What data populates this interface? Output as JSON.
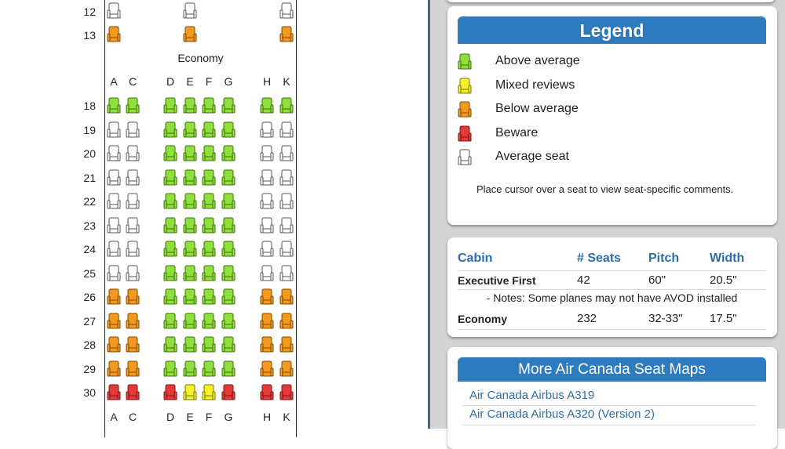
{
  "seat_map": {
    "section_label": "Economy",
    "colors": {
      "above": "#8fe03a",
      "mixed": "#f5f02a",
      "below": "#f39a1e",
      "beware": "#e43b37",
      "average": "#ffffff"
    },
    "columns": [
      "A",
      "C",
      "D",
      "E",
      "F",
      "G",
      "H",
      "K"
    ],
    "upper_rows": [
      {
        "row": "12",
        "seats": {
          "A": "average",
          "E": "average",
          "K": "average"
        }
      },
      {
        "row": "13",
        "seats": {
          "A": "below",
          "E": "below",
          "K": "below"
        }
      }
    ],
    "rows": [
      {
        "row": "18",
        "seats": [
          "above",
          "above",
          "above",
          "above",
          "above",
          "above",
          "above",
          "above"
        ]
      },
      {
        "row": "19",
        "seats": [
          "average",
          "average",
          "above",
          "above",
          "above",
          "above",
          "average",
          "average"
        ]
      },
      {
        "row": "20",
        "seats": [
          "average",
          "average",
          "above",
          "above",
          "above",
          "above",
          "average",
          "average"
        ]
      },
      {
        "row": "21",
        "seats": [
          "average",
          "average",
          "above",
          "above",
          "above",
          "above",
          "average",
          "average"
        ]
      },
      {
        "row": "22",
        "seats": [
          "average",
          "average",
          "above",
          "above",
          "above",
          "above",
          "average",
          "average"
        ]
      },
      {
        "row": "23",
        "seats": [
          "average",
          "average",
          "above",
          "above",
          "above",
          "above",
          "average",
          "average"
        ]
      },
      {
        "row": "24",
        "seats": [
          "average",
          "average",
          "above",
          "above",
          "above",
          "above",
          "average",
          "average"
        ]
      },
      {
        "row": "25",
        "seats": [
          "average",
          "average",
          "above",
          "above",
          "above",
          "above",
          "average",
          "average"
        ]
      },
      {
        "row": "26",
        "seats": [
          "below",
          "below",
          "above",
          "above",
          "above",
          "above",
          "below",
          "below"
        ]
      },
      {
        "row": "27",
        "seats": [
          "below",
          "below",
          "above",
          "above",
          "above",
          "above",
          "below",
          "below"
        ]
      },
      {
        "row": "28",
        "seats": [
          "below",
          "below",
          "above",
          "above",
          "above",
          "above",
          "below",
          "below"
        ]
      },
      {
        "row": "29",
        "seats": [
          "below",
          "below",
          "above",
          "above",
          "above",
          "above",
          "below",
          "below"
        ]
      },
      {
        "row": "30",
        "seats": [
          "beware",
          "beware",
          "beware",
          "mixed",
          "mixed",
          "beware",
          "beware",
          "beware"
        ]
      }
    ]
  },
  "legend": {
    "title": "Legend",
    "items": [
      {
        "type": "above",
        "label": "Above average"
      },
      {
        "type": "mixed",
        "label": "Mixed reviews"
      },
      {
        "type": "below",
        "label": "Below average"
      },
      {
        "type": "beware",
        "label": "Beware"
      },
      {
        "type": "average",
        "label": "Average seat"
      }
    ],
    "note": "Place cursor over a seat to view seat-specific comments."
  },
  "cabin_table": {
    "headers": [
      "Cabin",
      "# Seats",
      "Pitch",
      "Width"
    ],
    "rows": [
      {
        "cabin": "Executive First",
        "seats": "42",
        "pitch": "60\"",
        "width": "20.5\""
      },
      {
        "cabin": "Economy",
        "seats": "232",
        "pitch": "32-33\"",
        "width": "17.5\""
      }
    ],
    "note": "- Notes: Some planes may not have AVOD installed"
  },
  "more_maps": {
    "title": "More Air Canada Seat Maps",
    "links": [
      "Air Canada Airbus A319",
      "Air Canada Airbus A320 (Version 2)"
    ]
  }
}
